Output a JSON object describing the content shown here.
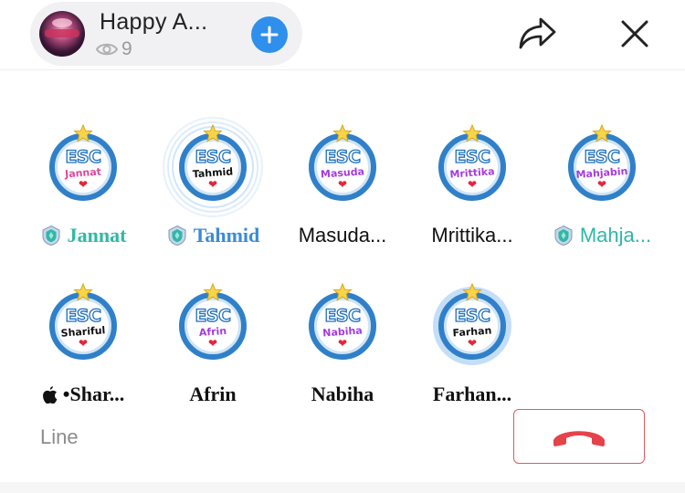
{
  "header": {
    "room_name": "Happy A...",
    "viewer_count": "9"
  },
  "colors": {
    "accent_blue": "#2f8fec",
    "hangup_red": "#e15a5e",
    "badge_blue": "#2f80c9",
    "teal_name": "#2fb8a6"
  },
  "speakers": [
    {
      "display_name": "Jannat",
      "badge_text": "ESC",
      "badge_name": "Jannat",
      "badge_color": "#e0469a",
      "has_shield": true,
      "speaking": false,
      "style": "serif-teal"
    },
    {
      "display_name": "Tahmid",
      "badge_text": "ESC",
      "badge_name": "Tahmid",
      "badge_color": "#111111",
      "has_shield": true,
      "speaking": true,
      "style": "serif-blue"
    },
    {
      "display_name": "Masuda...",
      "badge_text": "ESC",
      "badge_name": "Masuda",
      "badge_color": "#a43be0",
      "has_shield": false,
      "speaking": false,
      "style": "sans-black"
    },
    {
      "display_name": "Mrittika...",
      "badge_text": "ESC",
      "badge_name": "Mrittika",
      "badge_color": "#a43be0",
      "has_shield": false,
      "speaking": false,
      "style": "sans-black"
    },
    {
      "display_name": "Mahja...",
      "badge_text": "ESC",
      "badge_name": "Mahjabin",
      "badge_color": "#a43be0",
      "has_shield": true,
      "speaking": false,
      "style": "sans-teal"
    },
    {
      "display_name": "•Shar...",
      "badge_text": "ESC",
      "badge_name": "Shariful",
      "badge_color": "#111111",
      "has_shield": false,
      "speaking": false,
      "style": "serif-black",
      "apple_prefix": true
    },
    {
      "display_name": "Afrin",
      "badge_text": "ESC",
      "badge_name": "Afrin",
      "badge_color": "#a43be0",
      "has_shield": false,
      "speaking": false,
      "style": "serif-black"
    },
    {
      "display_name": "Nabiha",
      "badge_text": "ESC",
      "badge_name": "Nabiha",
      "badge_color": "#a43be0",
      "has_shield": false,
      "speaking": false,
      "style": "serif-black"
    },
    {
      "display_name": "Farhan...",
      "badge_text": "ESC",
      "badge_name": "Farhan",
      "badge_color": "#111111",
      "has_shield": false,
      "speaking": false,
      "style": "serif-black",
      "highlight": true
    }
  ],
  "footer": {
    "line_label": "Line"
  }
}
